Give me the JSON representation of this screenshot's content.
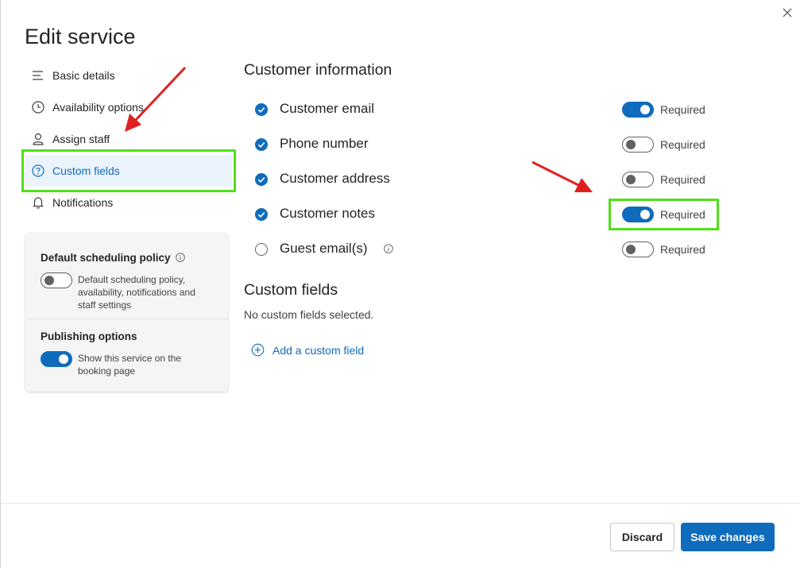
{
  "dialog": {
    "title": "Edit service",
    "close_icon": "close-icon"
  },
  "nav": {
    "items": [
      {
        "label": "Basic details",
        "icon": "lines-icon",
        "active": false
      },
      {
        "label": "Availability options",
        "icon": "clock-icon",
        "active": false
      },
      {
        "label": "Assign staff",
        "icon": "person-icon",
        "active": false
      },
      {
        "label": "Custom fields",
        "icon": "question-circle-icon",
        "active": true
      },
      {
        "label": "Notifications",
        "icon": "bell-icon",
        "active": false
      }
    ]
  },
  "policy_card": {
    "default_policy_title": "Default scheduling policy",
    "default_policy_toggle_on": false,
    "default_policy_desc": "Default scheduling policy, availability, notifications and staff settings",
    "publishing_title": "Publishing options",
    "publishing_toggle_on": true,
    "publishing_desc": "Show this service on the booking page"
  },
  "customer_info": {
    "title": "Customer information",
    "required_label": "Required",
    "fields": [
      {
        "label": "Customer email",
        "checked": true,
        "required": true
      },
      {
        "label": "Phone number",
        "checked": true,
        "required": false
      },
      {
        "label": "Customer address",
        "checked": true,
        "required": false
      },
      {
        "label": "Customer notes",
        "checked": true,
        "required": true
      },
      {
        "label": "Guest email(s)",
        "checked": false,
        "required": false
      }
    ]
  },
  "custom_fields": {
    "title": "Custom fields",
    "empty_text": "No custom fields selected.",
    "add_label": "Add a custom field"
  },
  "footer": {
    "discard_label": "Discard",
    "save_label": "Save changes"
  },
  "colors": {
    "accent": "#0f6cbd",
    "highlight": "#4fe01a",
    "annotation_arrow": "#e02020"
  }
}
